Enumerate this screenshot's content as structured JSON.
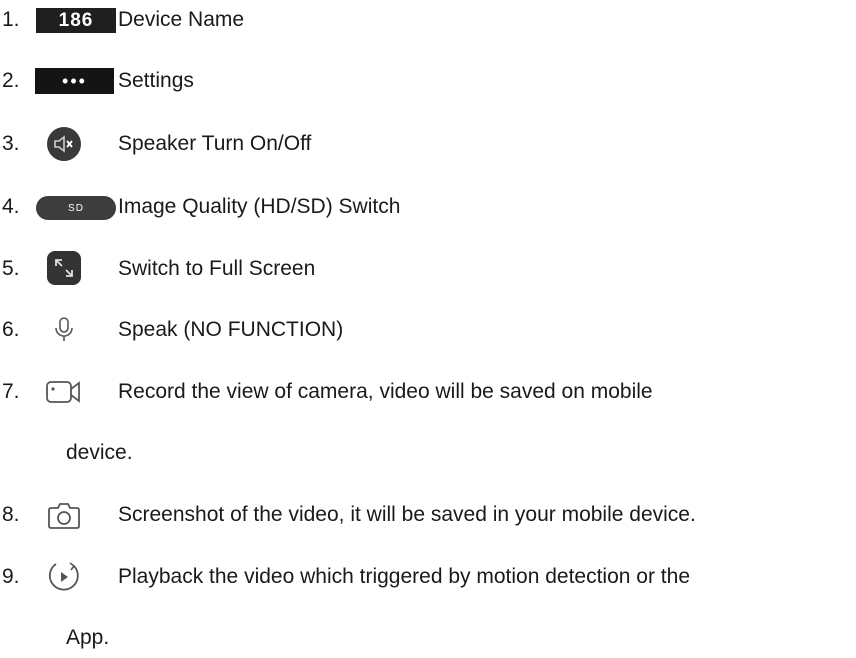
{
  "items": [
    {
      "num": "1.",
      "icon": "badge-186",
      "icon_text": "186",
      "text": "Device Name"
    },
    {
      "num": "2.",
      "icon": "more-dots-icon",
      "icon_text": "•••",
      "text": "Settings"
    },
    {
      "num": "3.",
      "icon": "speaker-mute-icon",
      "text": "Speaker Turn On/Off"
    },
    {
      "num": "4.",
      "icon": "sd-quality-pill",
      "icon_text": "SD",
      "text": "Image Quality (HD/SD) Switch"
    },
    {
      "num": "5.",
      "icon": "fullscreen-icon",
      "text": "Switch to Full Screen"
    },
    {
      "num": "6.",
      "icon": "microphone-icon",
      "text": "Speak (NO FUNCTION)"
    },
    {
      "num": "7.",
      "icon": "video-camera-icon",
      "text": "Record the view of camera, video will be saved on mobile",
      "continuation": "device."
    },
    {
      "num": "8.",
      "icon": "camera-icon",
      "text": "Screenshot of the video, it will be saved in your mobile device."
    },
    {
      "num": "9.",
      "icon": "playback-icon",
      "text": "Playback the video which triggered by motion detection or the",
      "continuation": "App."
    }
  ]
}
